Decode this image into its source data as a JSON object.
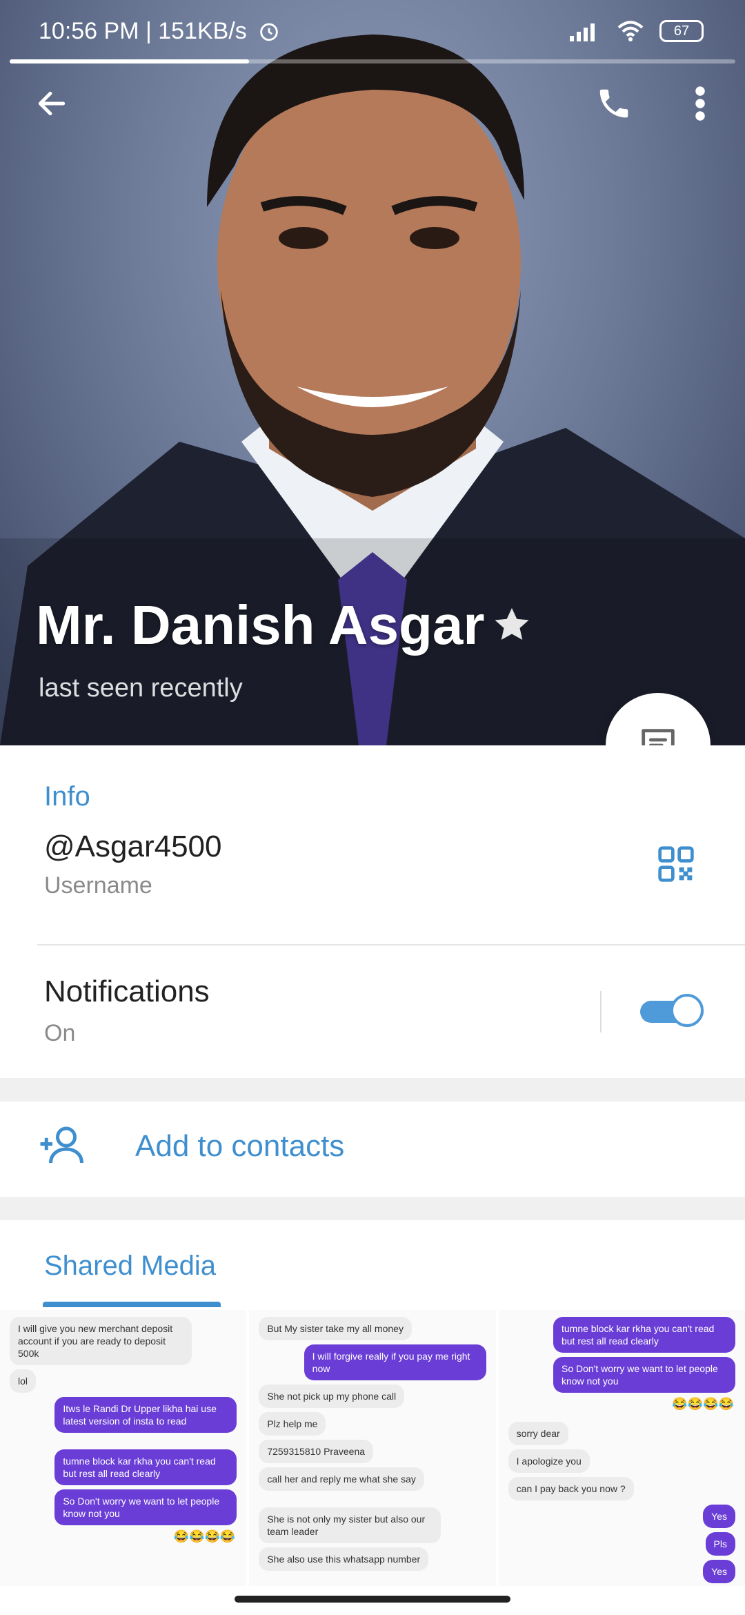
{
  "status_bar": {
    "time_speed": "10:56 PM | 151KB/s",
    "battery": "67"
  },
  "story_progress": 0.33,
  "profile": {
    "name": "Mr. Danish Asgar",
    "last_seen": "last seen recently"
  },
  "info": {
    "title": "Info",
    "username_value": "@Asgar4500",
    "username_label": "Username",
    "notifications_label": "Notifications",
    "notifications_value": "On",
    "notifications_enabled": true
  },
  "actions": {
    "add_to_contacts": "Add to contacts"
  },
  "shared_media": {
    "title": "Shared Media",
    "thumbs": [
      {
        "bubbles": [
          {
            "t": "I will give you new merchant deposit account if you are ready to deposit 500k",
            "dir": "in"
          },
          {
            "t": "lol",
            "dir": "in"
          },
          {
            "t": "Itws le Randi Dr Upper likha hai use latest version of insta to read",
            "dir": "out"
          },
          {
            "t": "tumne block kar rkha you can't read but rest all read clearly",
            "dir": "out"
          },
          {
            "t": "So Don't worry we want to let people know not you",
            "dir": "out"
          },
          {
            "t": "😂😂😂😂",
            "dir": "emoji"
          }
        ]
      },
      {
        "bubbles": [
          {
            "t": "But My sister take my all money",
            "dir": "in"
          },
          {
            "t": "I will forgive really if you pay me right now",
            "dir": "out"
          },
          {
            "t": "She not pick up my phone call",
            "dir": "in"
          },
          {
            "t": "Plz help me",
            "dir": "in"
          },
          {
            "t": "7259315810 Praveena",
            "dir": "in"
          },
          {
            "t": "call her and reply me what she say",
            "dir": "in"
          },
          {
            "t": "She is not only my sister but also our team leader",
            "dir": "in"
          },
          {
            "t": "She also use this whatsapp number",
            "dir": "in"
          }
        ]
      },
      {
        "bubbles": [
          {
            "t": "tumne block kar rkha you can't read but rest all read clearly",
            "dir": "out"
          },
          {
            "t": "So Don't worry we want to let people know not you",
            "dir": "out"
          },
          {
            "t": "😂😂😂😂",
            "dir": "emoji"
          },
          {
            "t": "sorry dear",
            "dir": "in"
          },
          {
            "t": "I apologize you",
            "dir": "in"
          },
          {
            "t": "can I pay back you now ?",
            "dir": "in"
          },
          {
            "t": "Yes",
            "dir": "out"
          },
          {
            "t": "Pls",
            "dir": "out"
          },
          {
            "t": "Yes",
            "dir": "out"
          }
        ]
      }
    ]
  },
  "colors": {
    "accent": "#3f8fcf",
    "toggle": "#4f9ad9",
    "bubble_out": "#6a3ed6",
    "bubble_in": "#ececec"
  },
  "icons": [
    "back-arrow-icon",
    "phone-icon",
    "more-vert-icon",
    "star-icon",
    "message-icon",
    "qr-code-icon",
    "add-person-icon",
    "alarm-icon",
    "signal-icon",
    "wifi-icon"
  ]
}
